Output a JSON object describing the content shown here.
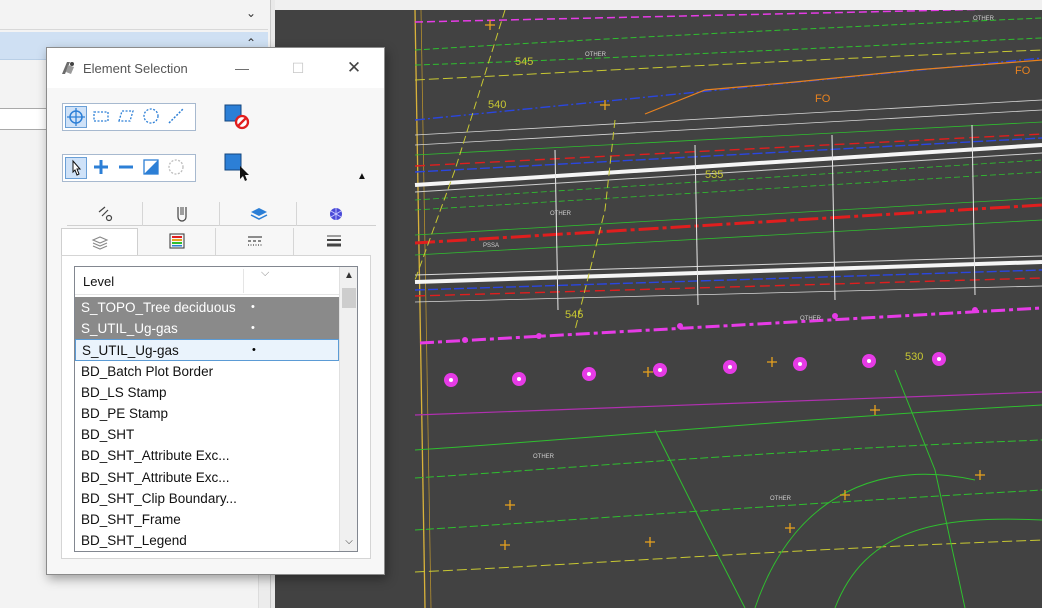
{
  "dialog": {
    "title": "Element Selection",
    "minimize_glyph": "—",
    "maximize_glyph": "☐",
    "close_glyph": "✕"
  },
  "toolbar": {
    "method_tools": [
      "individual-method",
      "block-method",
      "shape-method",
      "circle-method",
      "line-method"
    ],
    "mode_tools": [
      "new-mode",
      "add-mode",
      "subtract-mode",
      "invert-mode",
      "clear-mode"
    ],
    "collapse_glyph": "▲"
  },
  "tabs_row1": [
    "general-tab",
    "properties-tab",
    "symbology-tab",
    "materials-tab"
  ],
  "tabs_row2": [
    "levels-tab",
    "color-tab",
    "line-style-tab",
    "weight-tab"
  ],
  "list": {
    "header": "Level",
    "header_chevron": "⌵",
    "rows": [
      {
        "label": "S_TOPO_Tree deciduous",
        "dot": "•",
        "state": "selected-gray"
      },
      {
        "label": "S_UTIL_Ug-gas",
        "dot": "•",
        "state": "selected-gray"
      },
      {
        "label": "S_UTIL_Ug-gas",
        "dot": "•",
        "state": "selected-focus"
      },
      {
        "label": "BD_Batch Plot Border",
        "dot": "",
        "state": ""
      },
      {
        "label": "BD_LS Stamp",
        "dot": "",
        "state": ""
      },
      {
        "label": "BD_PE Stamp",
        "dot": "",
        "state": ""
      },
      {
        "label": "BD_SHT",
        "dot": "",
        "state": ""
      },
      {
        "label": "BD_SHT_Attribute Exc...",
        "dot": "",
        "state": ""
      },
      {
        "label": "BD_SHT_Attribute Exc...",
        "dot": "",
        "state": ""
      },
      {
        "label": "BD_SHT_Clip Boundary...",
        "dot": "",
        "state": ""
      },
      {
        "label": "BD_SHT_Frame",
        "dot": "",
        "state": ""
      },
      {
        "label": "BD_SHT_Legend",
        "dot": "",
        "state": ""
      }
    ],
    "scroll_up_glyph": "▲",
    "scroll_down_glyph": "⌵"
  },
  "canvas_labels": {
    "contour_1": "545",
    "contour_2": "540",
    "contour_3": "535",
    "contour_4": "545",
    "contour_5": "530",
    "fo_1": "FO",
    "fo_2": "FO",
    "pl_1": "OTHER",
    "pl_2": "OTHER",
    "pl_3": "OTHER",
    "pl_4": "OTHER",
    "pl_5": "OTHER",
    "pl_6": "PSSA",
    "pl_7": "OTHER"
  },
  "colors": {
    "canvas_bg": "#424242",
    "contour_green": "#32c832",
    "contour_yellow": "#c8c832",
    "util_blue": "#1f3fd8",
    "util_red": "#e01e1e",
    "gas_magenta": "#e63be6",
    "fo_orange": "#e8821e",
    "selection_blue": "#cfe2f8"
  }
}
